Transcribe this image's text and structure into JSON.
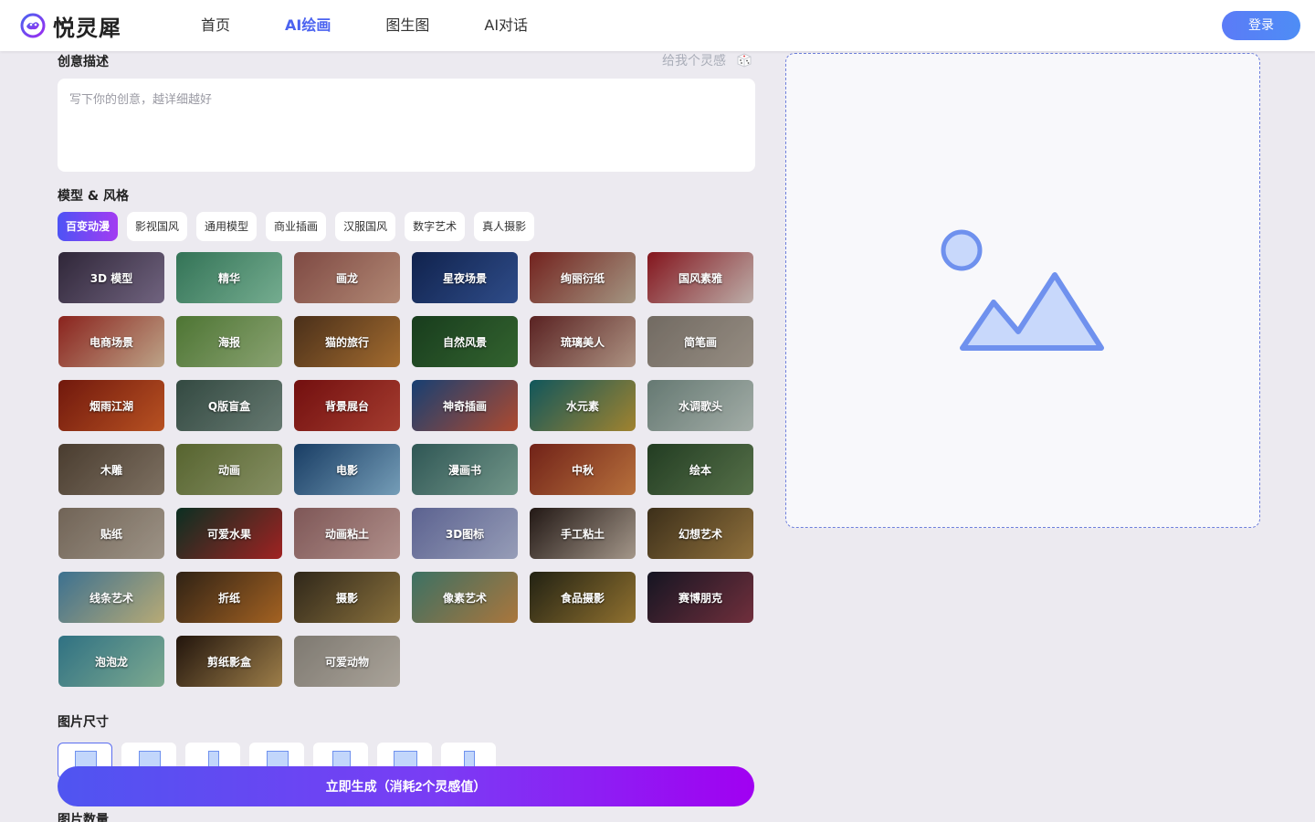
{
  "header": {
    "logo_text": "悦灵犀",
    "nav": [
      {
        "label": "首页",
        "active": false
      },
      {
        "label": "AI绘画",
        "active": true
      },
      {
        "label": "图生图",
        "active": false
      },
      {
        "label": "AI对话",
        "active": false
      }
    ],
    "login_label": "登录"
  },
  "prompt": {
    "label": "创意描述",
    "inspire_label": "给我个灵感",
    "placeholder": "写下你的创意，越详细越好",
    "value": ""
  },
  "styles": {
    "label": "模型 & 风格",
    "tabs": [
      {
        "label": "百变动漫",
        "active": true
      },
      {
        "label": "影视国风",
        "active": false
      },
      {
        "label": "通用模型",
        "active": false
      },
      {
        "label": "商业插画",
        "active": false
      },
      {
        "label": "汉服国风",
        "active": false
      },
      {
        "label": "数字艺术",
        "active": false
      },
      {
        "label": "真人摄影",
        "active": false
      }
    ],
    "items": [
      {
        "label": "3D 模型",
        "color1": "#3a2f45",
        "color2": "#8a7a9c"
      },
      {
        "label": "精华",
        "color1": "#3f8d6a",
        "color2": "#8fd3b0"
      },
      {
        "label": "画龙",
        "color1": "#9b5a52",
        "color2": "#d9a78f"
      },
      {
        "label": "星夜场景",
        "color1": "#142a5e",
        "color2": "#3a5ea8"
      },
      {
        "label": "绚丽衍纸",
        "color1": "#8c2a25",
        "color2": "#c9b8a0"
      },
      {
        "label": "国风素雅",
        "color1": "#a11a24",
        "color2": "#e6d5cf"
      },
      {
        "label": "电商场景",
        "color1": "#a92b24",
        "color2": "#e7c8a6"
      },
      {
        "label": "海报",
        "color1": "#5f8f3f",
        "color2": "#a9c78c"
      },
      {
        "label": "猫的旅行",
        "color1": "#5a3a20",
        "color2": "#c8843a"
      },
      {
        "label": "自然风景",
        "color1": "#1e4a24",
        "color2": "#3f7a3a"
      },
      {
        "label": "琉璃美人",
        "color1": "#6e2a2a",
        "color2": "#d4b4a0"
      },
      {
        "label": "简笔画",
        "color1": "#8b8278",
        "color2": "#b8ada0"
      },
      {
        "label": "烟雨江湖",
        "color1": "#8a1e10",
        "color2": "#e0642a"
      },
      {
        "label": "Q版盲盒",
        "color1": "#3f5a50",
        "color2": "#7d948a"
      },
      {
        "label": "背景展台",
        "color1": "#8c1313",
        "color2": "#c94a3a"
      },
      {
        "label": "神奇插画",
        "color1": "#1d4e8c",
        "color2": "#d45a3a"
      },
      {
        "label": "水元素",
        "color1": "#156a70",
        "color2": "#c4a03a"
      },
      {
        "label": "水调歌头",
        "color1": "#7c948c",
        "color2": "#c7d3cc"
      },
      {
        "label": "木雕",
        "color1": "#5a4a3a",
        "color2": "#9a8a78"
      },
      {
        "label": "动画",
        "color1": "#6a7a3a",
        "color2": "#a4b07a"
      },
      {
        "label": "电影",
        "color1": "#1e4a7a",
        "color2": "#8fc0e0"
      },
      {
        "label": "漫画书",
        "color1": "#3a6a68",
        "color2": "#8cb8a8"
      },
      {
        "label": "中秋",
        "color1": "#8a2a1e",
        "color2": "#e08a4a"
      },
      {
        "label": "绘本",
        "color1": "#2a4a2a",
        "color2": "#6a8a5a"
      },
      {
        "label": "贴纸",
        "color1": "#8a7a6a",
        "color2": "#c0b4a4"
      },
      {
        "label": "可爱水果",
        "color1": "#0e3a2a",
        "color2": "#c42a2a"
      },
      {
        "label": "动画粘土",
        "color1": "#9a6a6a",
        "color2": "#d8b0aa"
      },
      {
        "label": "3D图标",
        "color1": "#7078b0",
        "color2": "#b8c0e0"
      },
      {
        "label": "手工粘土",
        "color1": "#2a1e1a",
        "color2": "#c8b8a8"
      },
      {
        "label": "幻想艺术",
        "color1": "#4a3a20",
        "color2": "#b08a4a"
      },
      {
        "label": "线条艺术",
        "color1": "#4a8ab0",
        "color2": "#e0d090"
      },
      {
        "label": "折纸",
        "color1": "#3a2a1a",
        "color2": "#c8782a"
      },
      {
        "label": "摄影",
        "color1": "#3a3020",
        "color2": "#a88a4a"
      },
      {
        "label": "像素艺术",
        "color1": "#4a8a7a",
        "color2": "#d0904a"
      },
      {
        "label": "食品摄影",
        "color1": "#2a2a18",
        "color2": "#b08a3a"
      },
      {
        "label": "赛博朋克",
        "color1": "#1a1a2a",
        "color2": "#8a3a4a"
      },
      {
        "label": "泡泡龙",
        "color1": "#3a8aa0",
        "color2": "#9ad0b0"
      },
      {
        "label": "剪纸影盒",
        "color1": "#2a1a10",
        "color2": "#c09a5a"
      },
      {
        "label": "可爱动物",
        "color1": "#9a948a",
        "color2": "#d0c8bc"
      }
    ]
  },
  "size": {
    "label": "图片尺寸",
    "options": [
      {
        "name": "size-option-1",
        "shape": "square",
        "active": true
      },
      {
        "name": "size-option-2",
        "shape": "square",
        "active": false
      },
      {
        "name": "size-option-3",
        "shape": "tall",
        "active": false
      },
      {
        "name": "size-option-4",
        "shape": "square",
        "active": false
      },
      {
        "name": "size-option-5",
        "shape": "portrait",
        "active": false
      },
      {
        "name": "size-option-6",
        "shape": "wide",
        "active": false
      },
      {
        "name": "size-option-7",
        "shape": "tall",
        "active": false
      }
    ]
  },
  "count": {
    "label": "图片数量"
  },
  "generate_label": "立即生成（消耗2个灵感值）",
  "colors": {
    "accent": "#4b63f0",
    "gradient_start": "#4f55f1",
    "gradient_end": "#a100f2",
    "placeholder_icon": "#6f91ee"
  }
}
